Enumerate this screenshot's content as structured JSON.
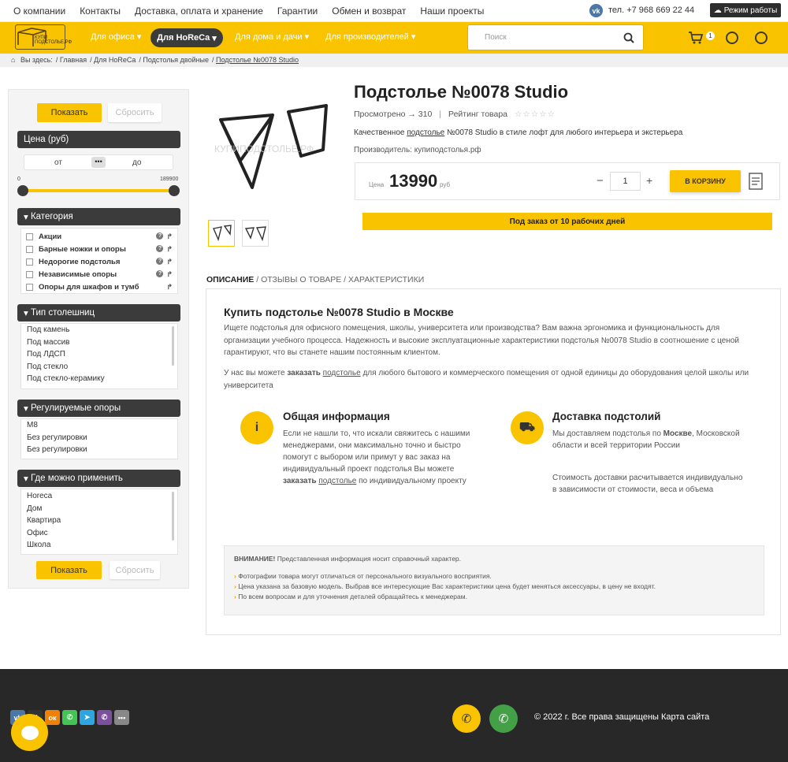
{
  "topbar": {
    "links": [
      "О компании",
      "Контакты",
      "Доставка, оплата и хранение",
      "Гарантии",
      "Обмен и возврат",
      "Наши проекты"
    ],
    "vk_label": "vk",
    "phone": "тел. +7 968 669 22 44",
    "mode": "Режим работы"
  },
  "header": {
    "logo_text": "КУПИ ПОДСТОЛЬЕ.РФ",
    "nav": [
      "Для офиса",
      "Для HoReCa",
      "Для дома и дачи",
      "Для производителей"
    ],
    "search_placeholder": "Поиск",
    "cart_count": "1"
  },
  "breadcrumb": {
    "prefix": "Вы здесь:",
    "items": [
      "Главная",
      "Для HoReCa",
      "Подстолья двойные",
      "Подстолье №0078 Studio"
    ]
  },
  "sidebar": {
    "show": "Показать",
    "reset": "Сбросить",
    "price": {
      "title": "Цена (руб)",
      "from": "от",
      "to": "до",
      "min": "0",
      "max": "189900"
    },
    "category": {
      "title": "Категория",
      "items": [
        "Акции",
        "Барные ножки и опоры",
        "Недорогие подстолья",
        "Независимые опоры",
        "Опоры для шкафов и тумб"
      ]
    },
    "tabletop": {
      "title": "Тип столешниц",
      "items": [
        "Под камень",
        "Под массив",
        "Под ЛДСП",
        "Под стекло",
        "Под стекло-керамику"
      ]
    },
    "adjust": {
      "title": "Регулируемые опоры",
      "items": [
        "М8",
        "Без регулировки",
        "Без регулировки"
      ]
    },
    "where": {
      "title": "Где можно применить",
      "items": [
        "Horeca",
        "Дом",
        "Квартира",
        "Офис",
        "Школа"
      ]
    }
  },
  "product": {
    "title": "Подстолье №0078 Studio",
    "views": "Просмотрено → 310",
    "rating_label": "Рейтинг товара",
    "stars": "☆☆☆☆☆",
    "desc_pre": "Качественное ",
    "desc_link": "подстолье",
    "desc_post": " №0078 Studio в стиле лофт для любого интерьера и экстерьера",
    "maker": "Производитель: купиподстолья.рф",
    "price_label": "Цена",
    "price": "13990",
    "currency": "руб",
    "qty": "1",
    "cart_btn": "В КОРЗИНУ",
    "order_note": "Под заказ от 10 рабочих дней",
    "watermark": "КУПИПОДСТОЛЬЕ.РФ"
  },
  "tabs": {
    "desc": "ОПИСАНИЕ",
    "reviews": "/ ОТЗЫВЫ О ТОВАРЕ",
    "chars": "/ ХАРАКТЕРИСТИКИ"
  },
  "content": {
    "heading": "Купить подстолье №0078 Studio в Москве",
    "p1": "Ищете подстолья для офисного помещения, школы, университета или производства? Вам важна эргономика и функциональность для организации учебного процесса. Надежность и высокие эксплуатационные характеристики подстолья №0078 Studio в соотношение с ценой гарантируют, что вы станете нашим постоянным клиентом.",
    "p2_pre": "У нас вы можете ",
    "p2_b": "заказать",
    "p2_link": "подстолье",
    "p2_post": " для любого бытового и коммерческого помещения от одной единицы до оборудования целой школы или университета",
    "info_title": "Общая информация",
    "info_text": "Если не нашли то, что искали свяжитесь с нашими менеджерами, они максимально точно и быстро помогут с выбором или примут у вас заказ на индивидуальный проект подстолья Вы можете",
    "info_b": "заказать",
    "info_link": "подстолье",
    "info_post": "по индивидуальному проекту",
    "delivery_title": "Доставка подстолий",
    "delivery_pre": "Мы доставляем подстолья по ",
    "delivery_b": "Москве",
    "delivery_post": ", Московской области и всей территории России",
    "delivery_p2": "Стоимость доставки расчитывается индивидуально в зависимости от стоимости, веса и объема",
    "warn_b": "ВНИМАНИЕ!",
    "warn_text": " Представленная информация носит справочный характер.",
    "warn_items": [
      "Фотографии товара могут отличаться от персонального визуального восприятия.",
      "Цена указана за базовую модель. Выбрав все интересующие Вас характеристики цена будет меняться аксессуары, в цену не входят.",
      "По всем вопросам и для уточнения деталей обращайтесь к менеджерам."
    ]
  },
  "footer": {
    "copyright": "© 2022 г. Все права защищены Карта сайта"
  }
}
